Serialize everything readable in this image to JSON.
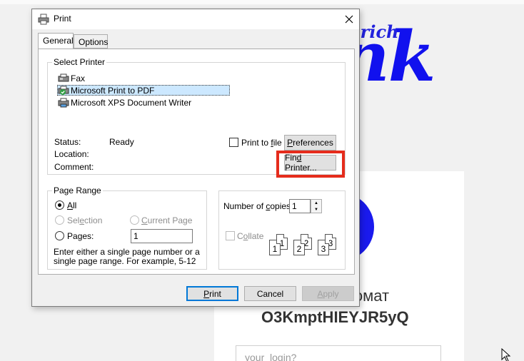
{
  "background": {
    "logo_small": "f rich",
    "logo_big": "nk",
    "title_line1": "комат",
    "title_line2": "O3KmptHIEYJR5yQ",
    "login_placeholder": "your_login?"
  },
  "dialog": {
    "title": "Print",
    "tabs": [
      "General",
      "Options"
    ],
    "select_printer": {
      "label": "Select Printer",
      "printers": [
        "Fax",
        "Microsoft Print to PDF",
        "Microsoft XPS Document Writer"
      ],
      "selected": "Microsoft Print to PDF"
    },
    "status": {
      "status_label": "Status:",
      "status_value": "Ready",
      "location_label": "Location:",
      "comment_label": "Comment:"
    },
    "print_to_file": {
      "label_pre": "Print to ",
      "label_ul": "f",
      "label_post": "ile",
      "checked": false
    },
    "preferences_button": {
      "ul": "P",
      "rest": "references"
    },
    "find_printer_button": {
      "pre": "Fin",
      "ul": "d",
      "post": " Printer..."
    },
    "page_range": {
      "label": "Page Range",
      "all_ul": "A",
      "all_rest": "ll",
      "selection_pre": "Sel",
      "selection_ul": "e",
      "selection_post": "ction",
      "current_ul": "C",
      "current_rest": "urrent Page",
      "pages_pre": "Pa",
      "pages_ul": "g",
      "pages_post": "es:",
      "pages_value": "1",
      "hint": "Enter either a single page number or a single page range.  For example, 5-12"
    },
    "copies": {
      "label_pre": "Number of ",
      "label_ul": "c",
      "label_post": "opies:",
      "value": "1",
      "collate_pre": "C",
      "collate_ul": "o",
      "collate_post": "llate",
      "collate_checked": false,
      "collate_pages": [
        "1",
        "1",
        "2",
        "2",
        "3",
        "3"
      ]
    },
    "buttons": {
      "print_pre": "",
      "print_ul": "P",
      "print_post": "rint",
      "cancel": "Cancel",
      "apply_ul": "A",
      "apply_rest": "pply"
    }
  },
  "colors": {
    "highlight_box": "#e52c1c",
    "logo_blue": "#1111ee",
    "selection_bg": "#cce8ff"
  }
}
